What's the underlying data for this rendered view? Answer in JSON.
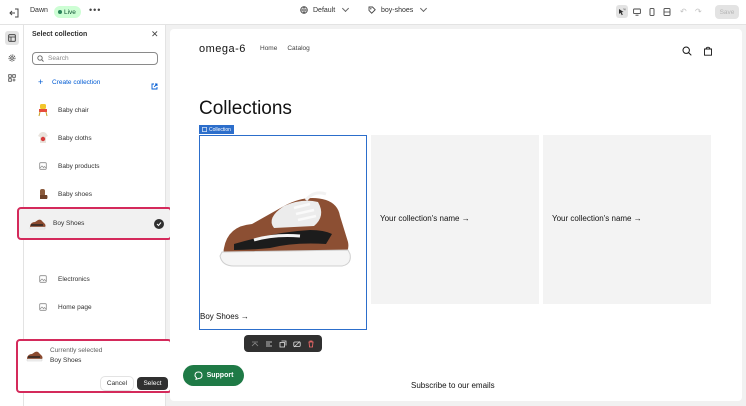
{
  "topbar": {
    "theme_name": "Dawn",
    "status_badge": "Live",
    "more_label": "•••",
    "template_label": "Default",
    "page_label": "boy-shoes",
    "save_label": "Save"
  },
  "panel": {
    "title": "Select collection",
    "search_placeholder": "Search",
    "create_label": "Create collection",
    "items": [
      {
        "label": "Baby chair",
        "icon": "baby-chair-thumbnail"
      },
      {
        "label": "Baby cloths",
        "icon": "baby-cloths-thumbnail"
      },
      {
        "label": "Baby products",
        "icon": "image-placeholder-icon"
      },
      {
        "label": "Baby shoes",
        "icon": "baby-shoes-thumbnail"
      },
      {
        "label": "Boy Shoes",
        "icon": "boy-shoes-thumbnail",
        "selected": true
      },
      {
        "label": "Electronics",
        "icon": "image-placeholder-icon"
      },
      {
        "label": "Home page",
        "icon": "image-placeholder-icon"
      }
    ],
    "current_label": "Currently selected",
    "current_name": "Boy Shoes",
    "cancel_label": "Cancel",
    "select_label": "Select"
  },
  "preview": {
    "store_name": "omega-6",
    "nav": [
      "Home",
      "Catalog"
    ],
    "heading": "Collections",
    "tag_label": "Collection",
    "card1_label": "Boy Shoes →",
    "card_placeholder": "Your collection's name →",
    "subscribe": "Subscribe to our emails",
    "support_label": "Support"
  },
  "colors": {
    "highlight": "#d42a5b",
    "selection": "#2c6ecb",
    "support": "#1f7a46",
    "live_badge": "#cdfed4"
  }
}
